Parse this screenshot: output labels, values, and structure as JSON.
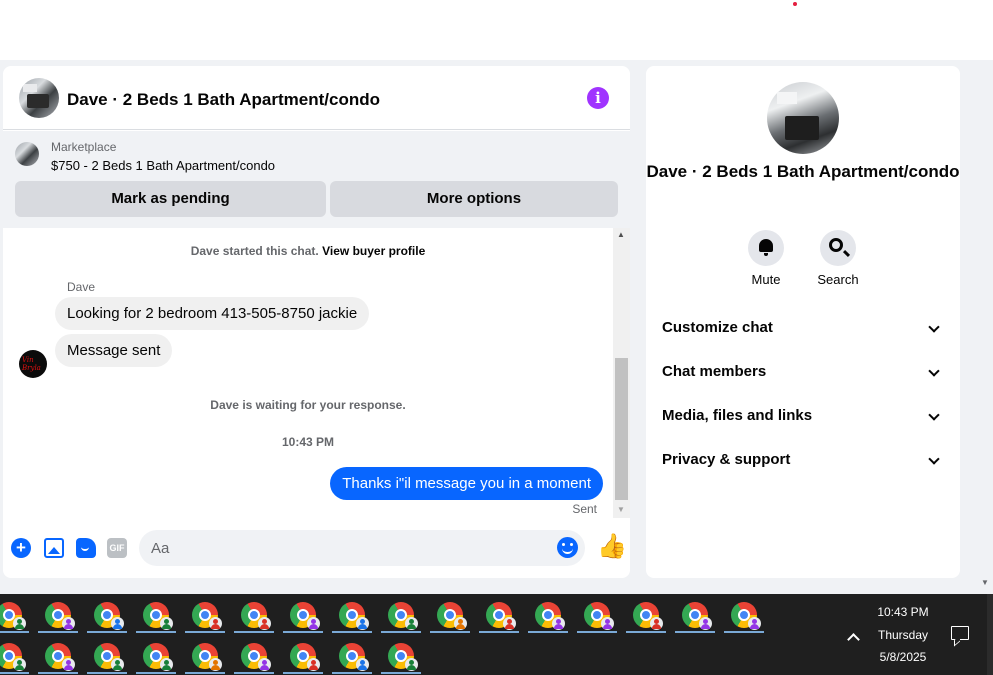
{
  "chat": {
    "title": "Dave · 2 Beds 1 Bath Apartment/condo",
    "marketplace_label": "Marketplace",
    "listing": "$750 - 2 Beds 1 Bath Apartment/condo",
    "mark_pending_label": "Mark as pending",
    "more_options_label": "More options",
    "system_start": "Dave started this chat.",
    "view_buyer_profile": "View buyer profile",
    "sender_name": "Dave",
    "incoming_messages": [
      "Looking for 2 bedroom 413-505-8750 jackie",
      "Message sent"
    ],
    "waiting_text": "Dave is waiting for your response.",
    "timestamp": "10:43 PM",
    "outgoing_message": "Thanks i\"il message you in a moment",
    "sent_status": "Sent",
    "input_placeholder": "Aa",
    "gif_label": "GIF",
    "dave_avatar_text": "Vin Bryla"
  },
  "details": {
    "title": "Dave · 2 Beds 1 Bath Apartment/condo",
    "mute_label": "Mute",
    "search_label": "Search",
    "sections": [
      "Customize chat",
      "Chat members",
      "Media, files and links",
      "Privacy & support"
    ]
  },
  "taskbar": {
    "time": "10:43 PM",
    "day": "Thursday",
    "date": "5/8/2025"
  },
  "colors": {
    "accent": "#0866ff",
    "info": "#a033ff",
    "page_bg": "#f0f2f5"
  }
}
